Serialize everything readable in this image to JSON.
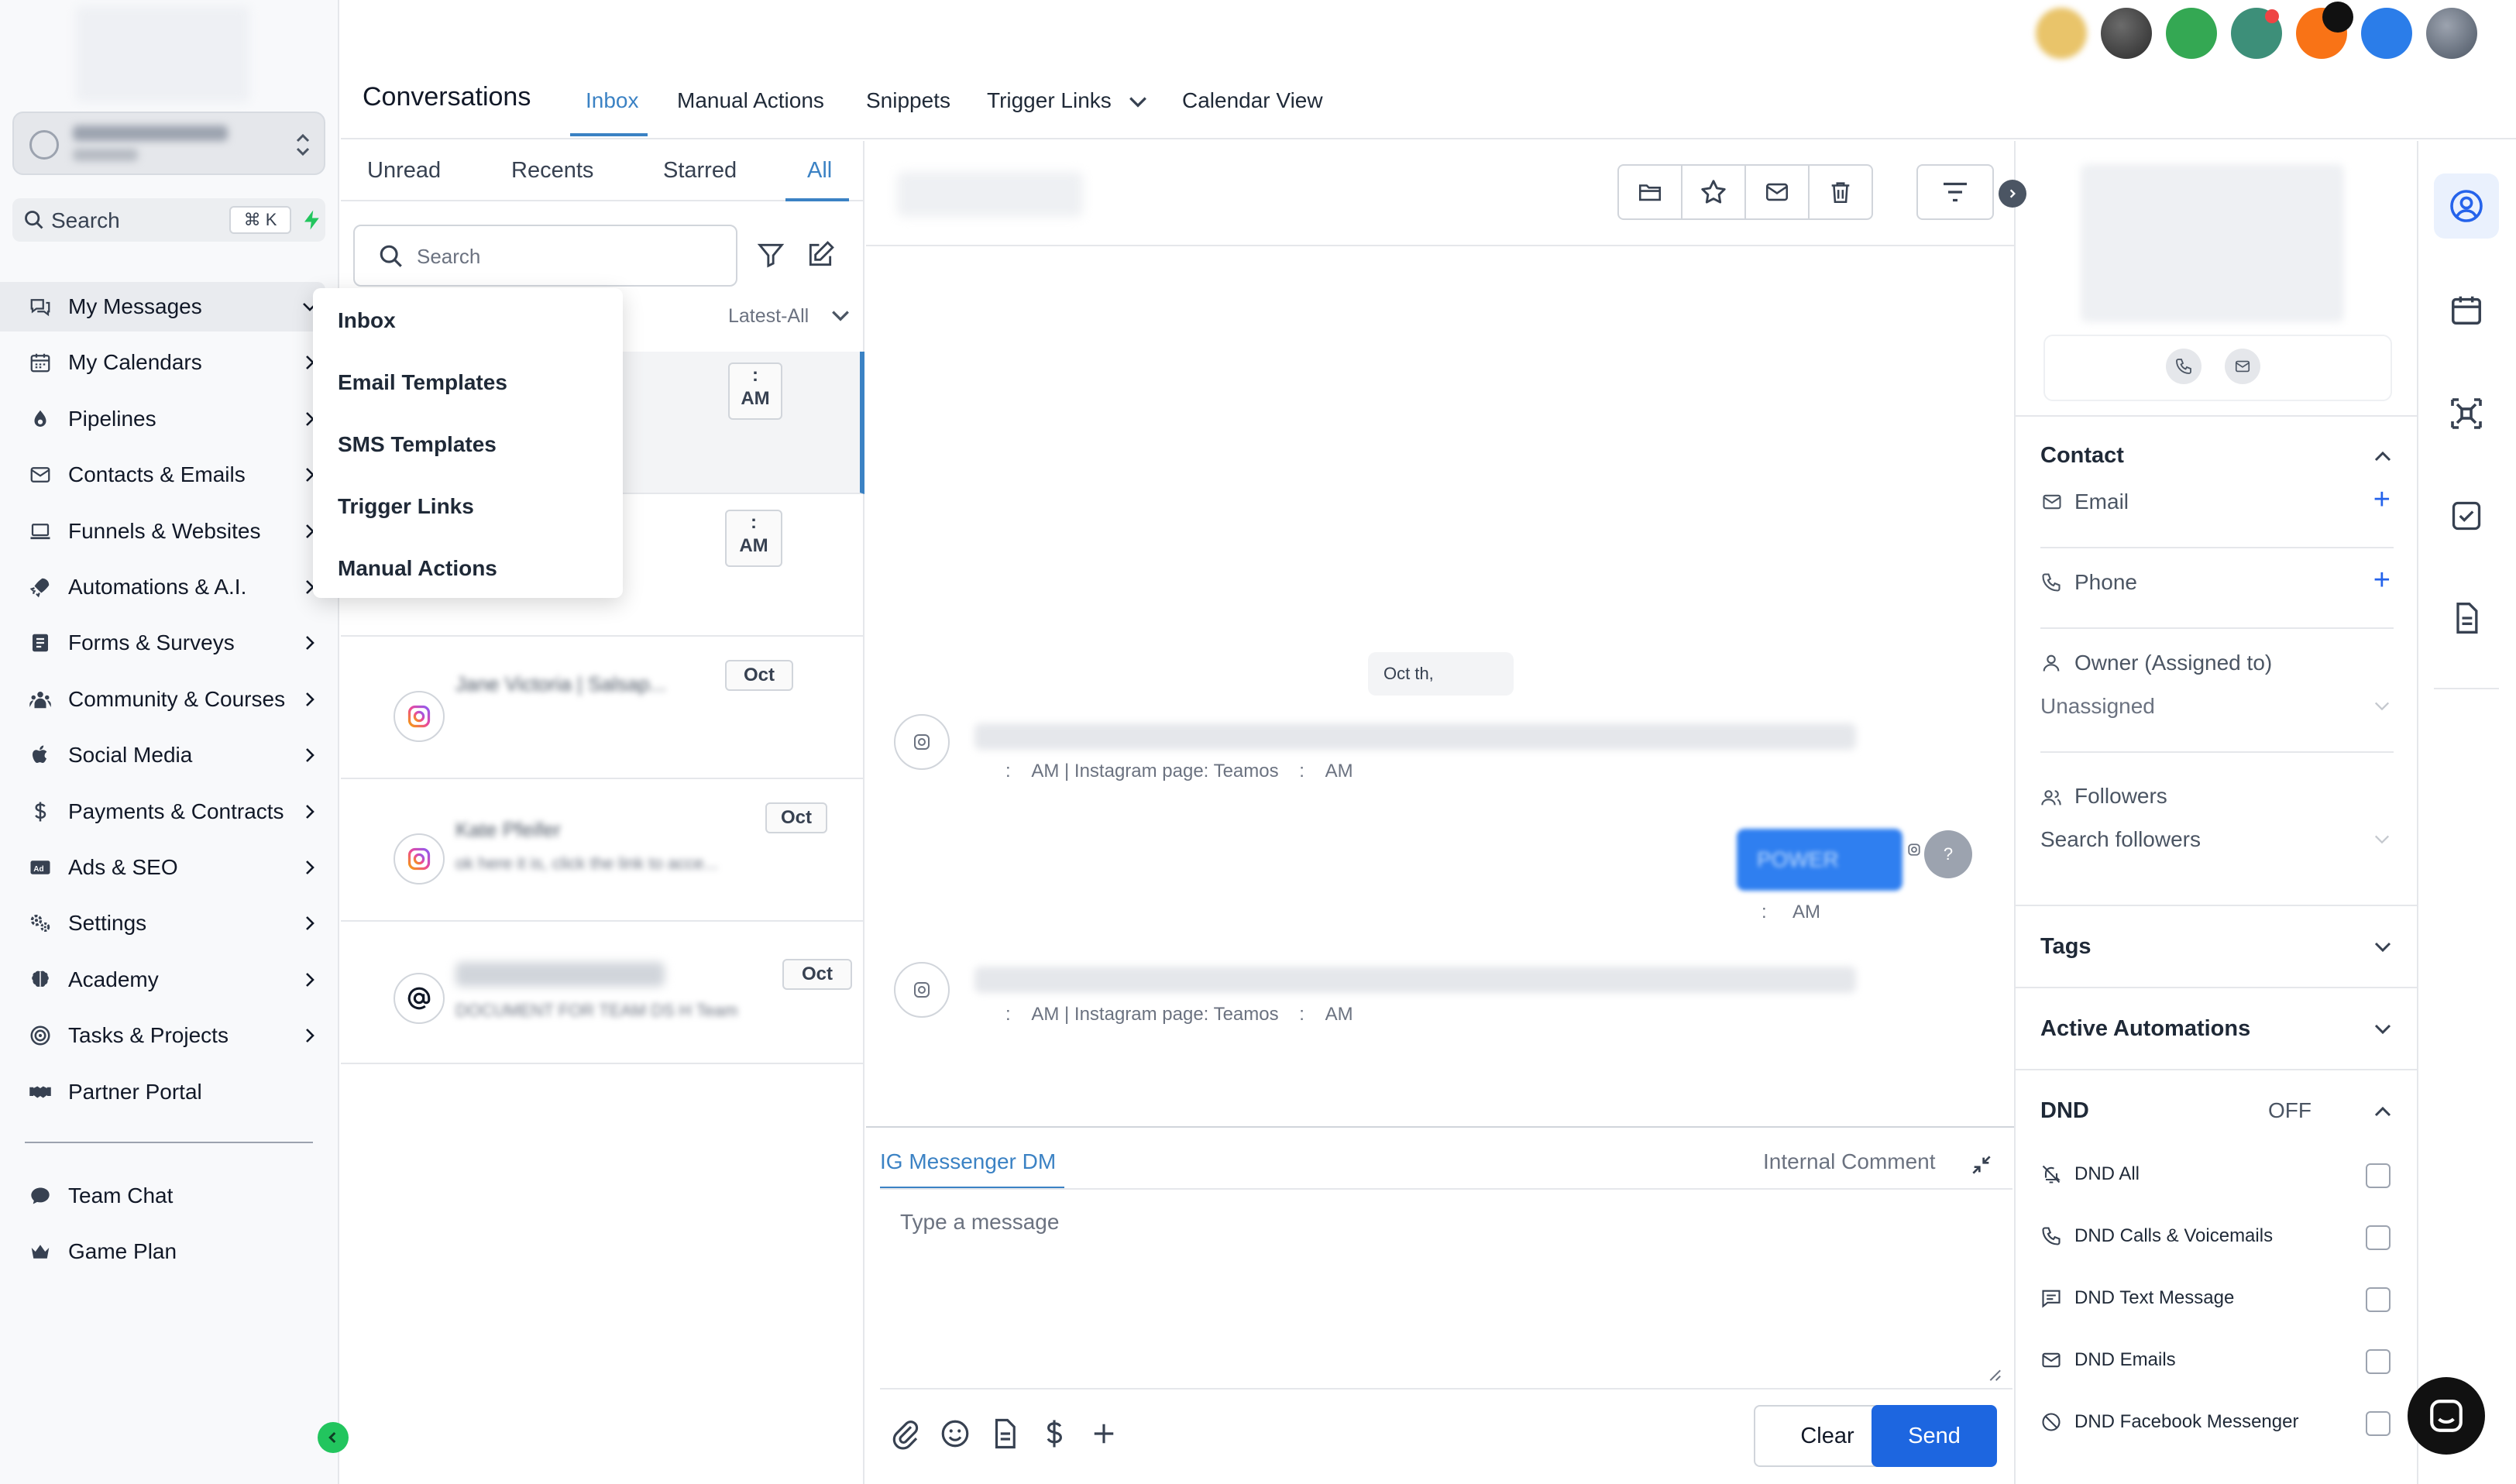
{
  "sidebar": {
    "search_label": "Search",
    "search_shortcut": "⌘ K",
    "items": [
      {
        "label": "My Messages",
        "icon": "messages-icon"
      },
      {
        "label": "My Calendars",
        "icon": "calendar-icon"
      },
      {
        "label": "Pipelines",
        "icon": "pipeline-icon"
      },
      {
        "label": "Contacts & Emails",
        "icon": "mail-icon"
      },
      {
        "label": "Funnels & Websites",
        "icon": "laptop-icon"
      },
      {
        "label": "Automations & A.I.",
        "icon": "rocket-icon"
      },
      {
        "label": "Forms & Surveys",
        "icon": "form-icon"
      },
      {
        "label": "Community & Courses",
        "icon": "community-icon"
      },
      {
        "label": "Social Media",
        "icon": "social-icon"
      },
      {
        "label": "Payments & Contracts",
        "icon": "dollar-icon"
      },
      {
        "label": "Ads & SEO",
        "icon": "ads-icon"
      },
      {
        "label": "Settings",
        "icon": "gear-icon"
      },
      {
        "label": "Academy",
        "icon": "brain-icon"
      },
      {
        "label": "Tasks & Projects",
        "icon": "target-icon"
      },
      {
        "label": "Partner Portal",
        "icon": "handshake-icon"
      }
    ],
    "bottom_items": [
      {
        "label": "Team Chat",
        "icon": "chat-bubble-icon"
      },
      {
        "label": "Game Plan",
        "icon": "crown-icon"
      }
    ]
  },
  "messages_menu": [
    "Inbox",
    "Email Templates",
    "SMS Templates",
    "Trigger Links",
    "Manual Actions"
  ],
  "header": {
    "title": "Conversations",
    "tabs": [
      "Inbox",
      "Manual Actions",
      "Snippets",
      "Trigger Links",
      "Calendar View"
    ],
    "active_tab": "Inbox"
  },
  "list": {
    "tabs": [
      "Unread",
      "Recents",
      "Starred",
      "All"
    ],
    "active_tab": "All",
    "search_placeholder": "Search",
    "sort_label": "Latest-All",
    "conversations": [
      {
        "name": "",
        "preview": "",
        "date": ":",
        "time": "AM",
        "channel": "none"
      },
      {
        "name": "",
        "preview": "",
        "date": ":",
        "time": "AM",
        "channel": "none"
      },
      {
        "name": "Jane Victoria | Salsap...",
        "preview": "",
        "date": "Oct",
        "time": "",
        "channel": "instagram"
      },
      {
        "name": "Kate Pfeifer",
        "preview": "ok here it is, click the link to acce...",
        "date": "Oct",
        "time": "",
        "channel": "instagram"
      },
      {
        "name": "",
        "preview": "DOCUMENT FOR TEAM DS H Team",
        "date": "Oct",
        "time": "",
        "channel": "email"
      }
    ]
  },
  "chat": {
    "date_chip": "Oct      th,",
    "messages": [
      {
        "meta_left": ":",
        "meta_mid": "AM | Instagram page: Teamos",
        "meta_sep": ":",
        "meta_right": "AM"
      },
      {
        "bubble": "POWER",
        "meta_left": ":",
        "meta_right": "AM",
        "avatar": "?"
      },
      {
        "meta_left": ":",
        "meta_mid": "AM | Instagram page: Teamos",
        "meta_sep": ":",
        "meta_right": "AM"
      }
    ],
    "composer": {
      "tab_active": "IG Messenger DM",
      "tab_other": "Internal Comment",
      "placeholder": "Type a message",
      "clear_label": "Clear",
      "send_label": "Send"
    }
  },
  "contact": {
    "section_contact": "Contact",
    "email_label": "Email",
    "phone_label": "Phone",
    "owner_label": "Owner (Assigned to)",
    "owner_value": "Unassigned",
    "followers_label": "Followers",
    "followers_placeholder": "Search followers",
    "tags_label": "Tags",
    "automations_label": "Active Automations",
    "dnd_label": "DND",
    "dnd_state": "OFF",
    "dnd_items": [
      "DND All",
      "DND Calls & Voicemails",
      "DND Text Message",
      "DND Emails",
      "DND Facebook Messenger"
    ]
  },
  "colors": {
    "accent": "#3b82c4",
    "send": "#1d66e0",
    "collapse": "#22c55e",
    "avatar_colors": [
      "#e9c46a",
      "#3f3f46",
      "#34a853",
      "#3d8f79",
      "#f97316",
      "#2b7de9",
      "#6b7280"
    ]
  }
}
